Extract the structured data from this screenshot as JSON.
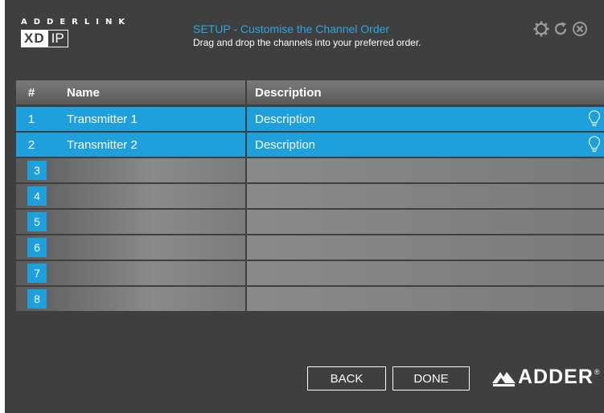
{
  "header": {
    "logo_top": "ADDERLINK",
    "logo_xd": "XD",
    "logo_ip": "IP",
    "title": "SETUP - Customise the Channel Order",
    "subtitle": "Drag and drop the channels into your preferred order.",
    "icons": [
      "gear-icon",
      "refresh-icon",
      "close-icon"
    ]
  },
  "table": {
    "columns": {
      "num": "#",
      "name": "Name",
      "description": "Description"
    },
    "rows": [
      {
        "num": "1",
        "name": "Transmitter 1",
        "description": "Description"
      },
      {
        "num": "2",
        "name": "Transmitter 2",
        "description": "Description"
      },
      {
        "num": "3",
        "name": "",
        "description": ""
      },
      {
        "num": "4",
        "name": "",
        "description": ""
      },
      {
        "num": "5",
        "name": "",
        "description": ""
      },
      {
        "num": "6",
        "name": "",
        "description": ""
      },
      {
        "num": "7",
        "name": "",
        "description": ""
      },
      {
        "num": "8",
        "name": "",
        "description": ""
      }
    ]
  },
  "footer": {
    "back_label": "BACK",
    "done_label": "DONE",
    "brand": "ADDER",
    "brand_reg": "®"
  },
  "colors": {
    "accent": "#1ea0dc",
    "background": "#3f3f3f",
    "title": "#29a8e0"
  }
}
